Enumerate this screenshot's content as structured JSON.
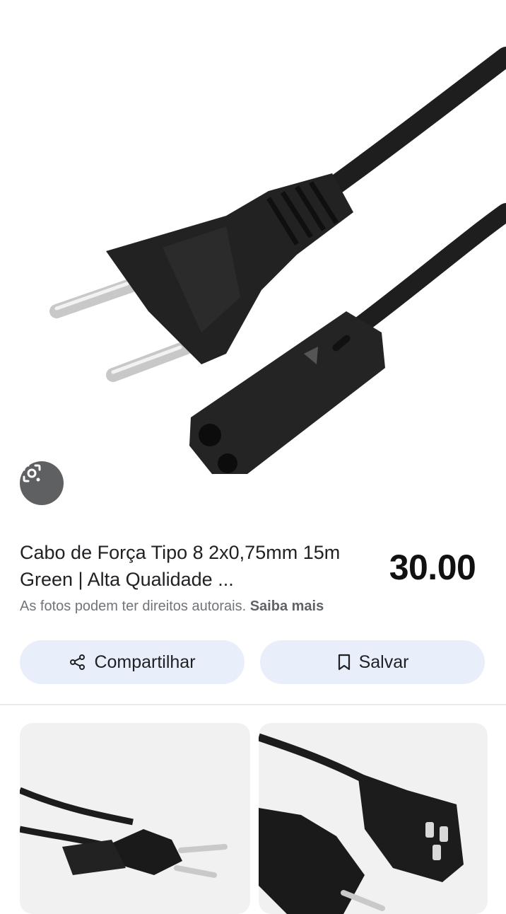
{
  "product": {
    "title": "Cabo de Força Tipo 8 2x0,75mm 15m Green | Alta Qualidade ...",
    "price": "30.00"
  },
  "notice": {
    "text": "As fotos podem ter direitos autorais.",
    "link": "Saiba mais"
  },
  "actions": {
    "share_label": "Compartilhar",
    "save_label": "Salvar"
  },
  "icons": {
    "lens": "lens-icon",
    "share": "share-icon",
    "bookmark": "bookmark-icon"
  },
  "colors": {
    "button_bg": "#e8effb",
    "lens_bg": "#5f6062",
    "text": "#202124",
    "muted": "#70757a"
  }
}
